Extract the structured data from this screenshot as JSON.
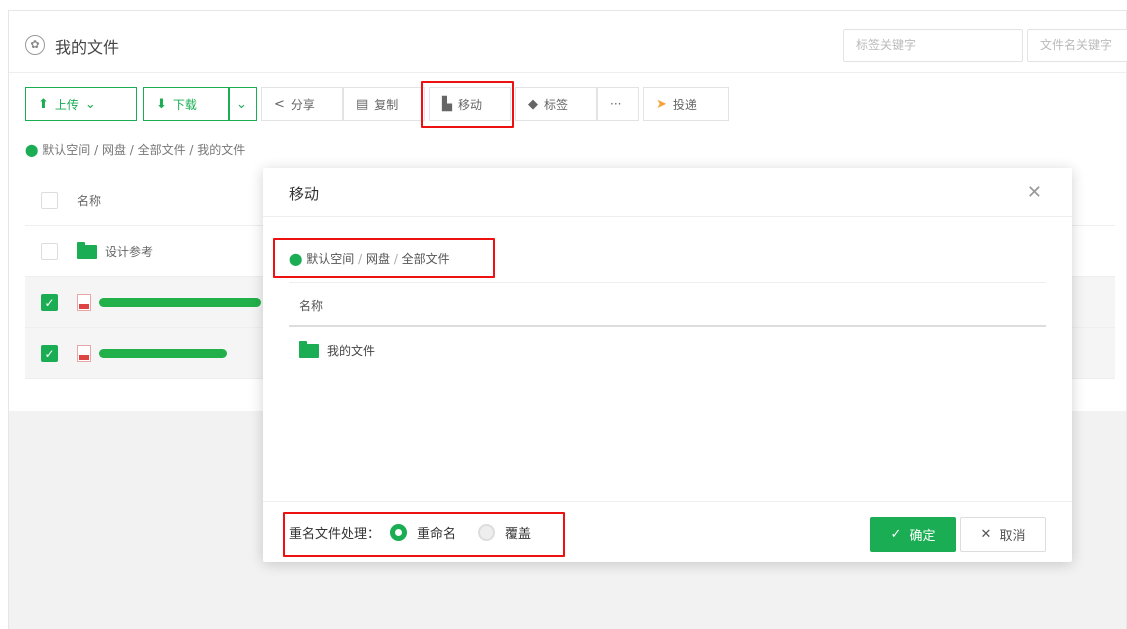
{
  "header": {
    "title": "我的文件",
    "tag_search_placeholder": "标签关键字",
    "name_search_placeholder": "文件名关键字"
  },
  "toolbar": {
    "upload": "上传",
    "download": "下载",
    "share": "分享",
    "copy": "复制",
    "move": "移动",
    "tag": "标签",
    "more": "···",
    "deliver": "投递"
  },
  "breadcrumb": "默认空间 / 网盘 / 全部文件 / 我的文件",
  "file_table": {
    "header": "名称",
    "rows": [
      {
        "name": "设计参考",
        "type": "folder",
        "selected": false
      }
    ]
  },
  "dialog": {
    "title": "移动",
    "path": [
      "默认空间",
      "网盘",
      "全部文件"
    ],
    "column": "名称",
    "folder": "我的文件",
    "rename_label": "重名文件处理：",
    "option_rename": "重命名",
    "option_overwrite": "覆盖",
    "confirm": "确定",
    "cancel": "取消"
  },
  "colors": {
    "accent": "#1aad53",
    "highlight": "#e11111"
  }
}
